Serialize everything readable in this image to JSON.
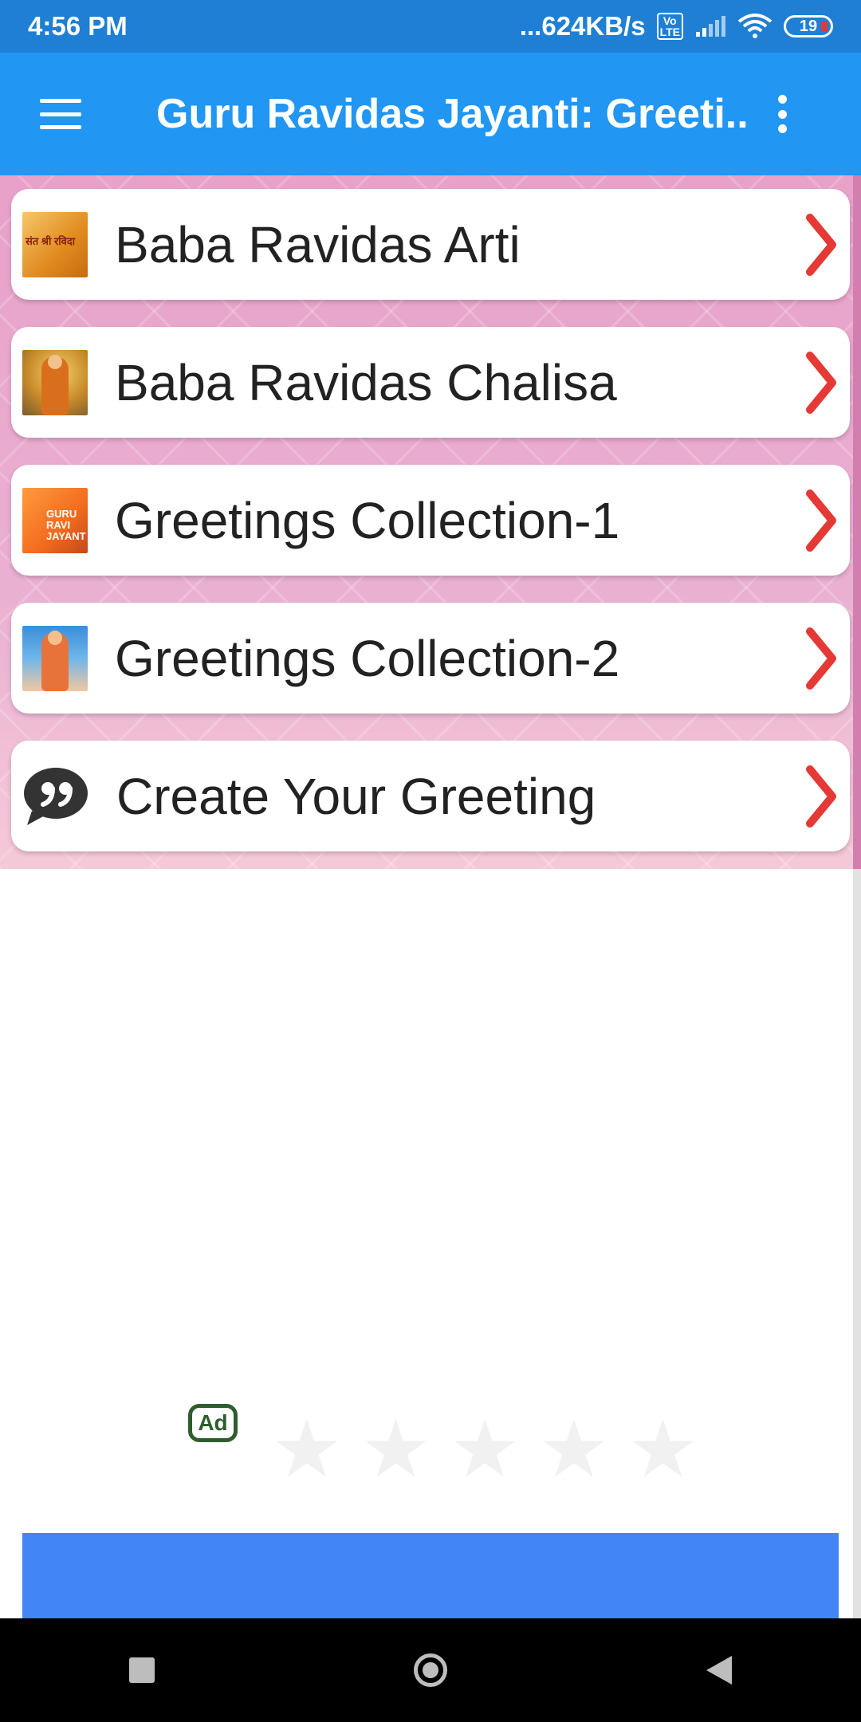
{
  "status_bar": {
    "time": "4:56 PM",
    "network_speed": "...624KB/s",
    "volte_label": "Vo\nLTE",
    "battery_level": "19",
    "icons": [
      "volte-icon",
      "signal-icon",
      "wifi-icon",
      "battery-icon"
    ]
  },
  "app_bar": {
    "title": "Guru Ravidas Jayanti: Greeti...",
    "menu_icon": "hamburger-menu-icon",
    "overflow_icon": "more-vert-icon"
  },
  "menu": {
    "items": [
      {
        "label": "Baba Ravidas Arti",
        "icon": "arti-thumbnail",
        "thumb_text": "संत श्री रविदा"
      },
      {
        "label": "Baba Ravidas Chalisa",
        "icon": "chalisa-thumbnail"
      },
      {
        "label": "Greetings Collection-1",
        "icon": "greetings-1-thumbnail",
        "thumb_text": "GURU RAVI JAYANT"
      },
      {
        "label": "Greetings Collection-2",
        "icon": "greetings-2-thumbnail"
      },
      {
        "label": "Create Your Greeting",
        "icon": "quote-bubble-icon"
      }
    ],
    "chevron_color": "#e53935"
  },
  "ad": {
    "badge": "Ad",
    "stars": "★★★★★",
    "cta_color": "#4285f4"
  },
  "colors": {
    "status_bar": "#1e7fd4",
    "app_bar": "#2196f3",
    "background_pink": "#e9a9cf"
  }
}
